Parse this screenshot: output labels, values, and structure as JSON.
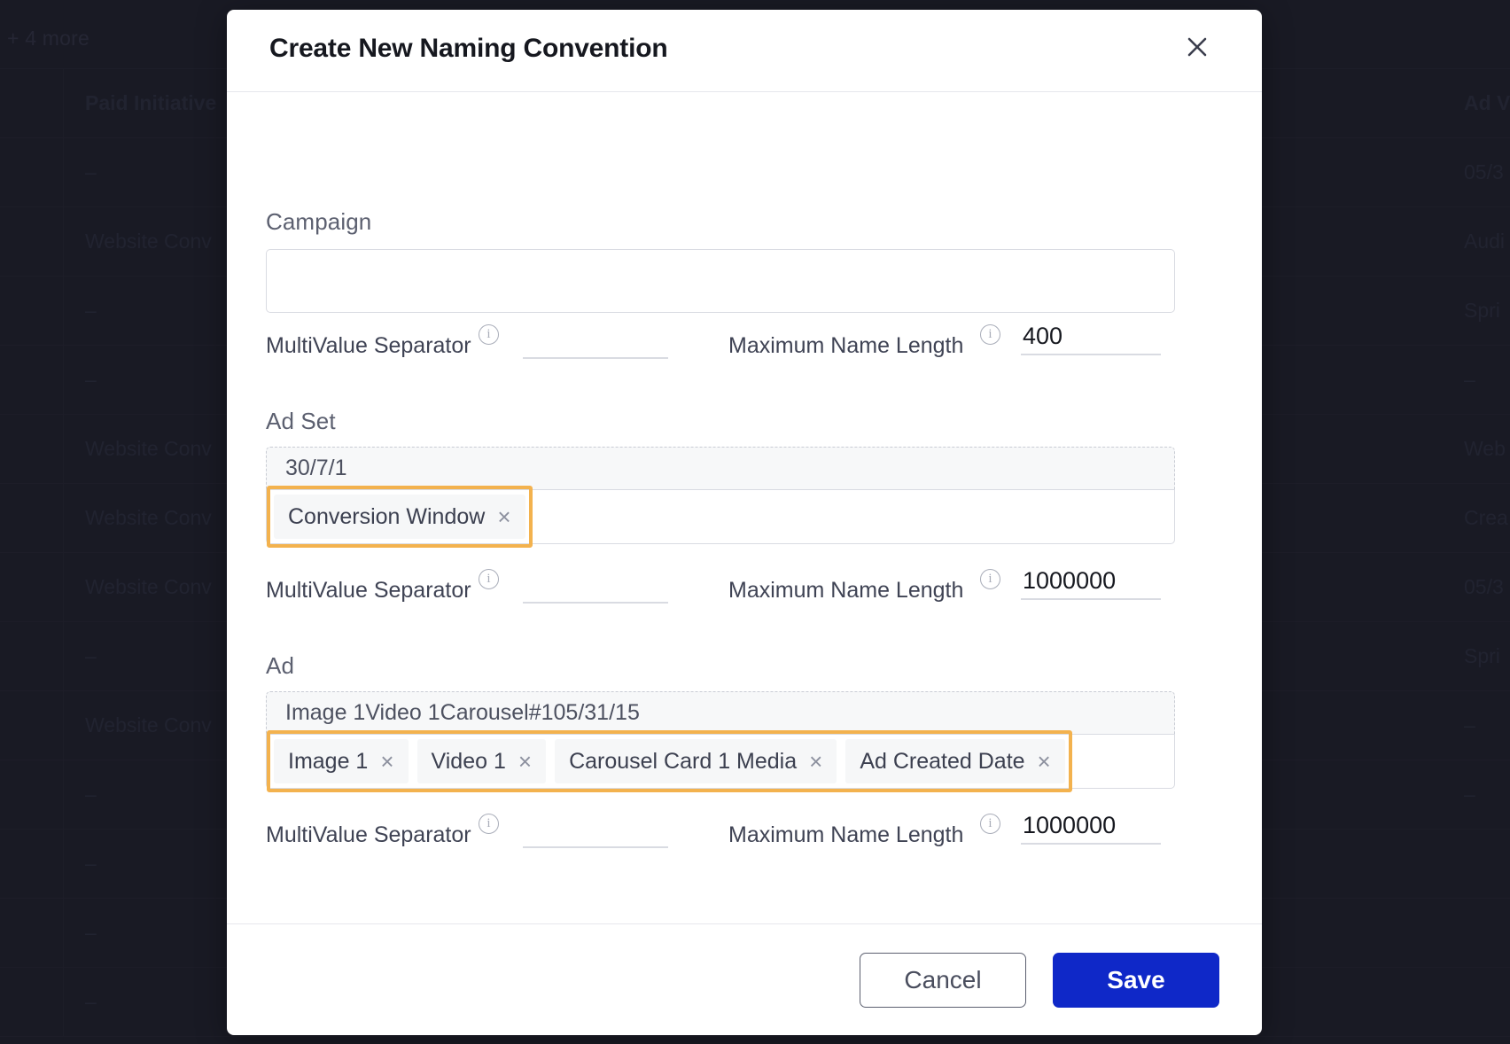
{
  "background": {
    "more_link": "+ 4 more",
    "columns": [
      "",
      "Paid Initiative",
      "Ad V"
    ],
    "rows": [
      {
        "b": "Paid Initiative",
        "c": "Ad V",
        "header": true
      },
      {
        "b": "–",
        "c": "05/3"
      },
      {
        "b": "Website Conv",
        "c": "Audi"
      },
      {
        "b": "–",
        "c": "Spri"
      },
      {
        "b": "–",
        "c": "–"
      },
      {
        "b": "Website Conv",
        "c": "Web"
      },
      {
        "b": "Website Conv",
        "c": "Crea"
      },
      {
        "b": "Website Conv",
        "c": "05/3"
      },
      {
        "b": "–",
        "c": "Spri"
      },
      {
        "b": "Website Conv",
        "c": "–"
      },
      {
        "b": "–",
        "c": "–"
      },
      {
        "b": "–",
        "c": ""
      },
      {
        "b": "–",
        "c": ""
      },
      {
        "b": "–",
        "c": ""
      }
    ]
  },
  "modal": {
    "title": "Create New Naming Convention",
    "close_icon": "close-icon",
    "sections": [
      {
        "label": "Campaign",
        "preview": "",
        "tags": [],
        "multivalue_separator_label": "MultiValue Separator",
        "multivalue_separator_value": "",
        "max_name_length_label": "Maximum Name Length",
        "max_name_length_value": "400"
      },
      {
        "label": "Ad Set",
        "preview": "30/7/1",
        "tags": [
          "Conversion Window"
        ],
        "multivalue_separator_label": "MultiValue Separator",
        "multivalue_separator_value": "",
        "max_name_length_label": "Maximum Name Length",
        "max_name_length_value": "1000000"
      },
      {
        "label": "Ad",
        "preview": "Image 1Video 1Carousel#105/31/15",
        "tags": [
          "Image 1",
          "Video 1",
          "Carousel Card 1 Media",
          "Ad Created Date"
        ],
        "multivalue_separator_label": "MultiValue Separator",
        "multivalue_separator_value": "",
        "max_name_length_label": "Maximum Name Length",
        "max_name_length_value": "1000000"
      }
    ],
    "tag_remove_glyph": "×",
    "footer": {
      "cancel_label": "Cancel",
      "save_label": "Save"
    }
  },
  "colors": {
    "highlight_orange": "#f3b24e",
    "save_blue": "#0f28c8",
    "overlay": "#22242f"
  }
}
